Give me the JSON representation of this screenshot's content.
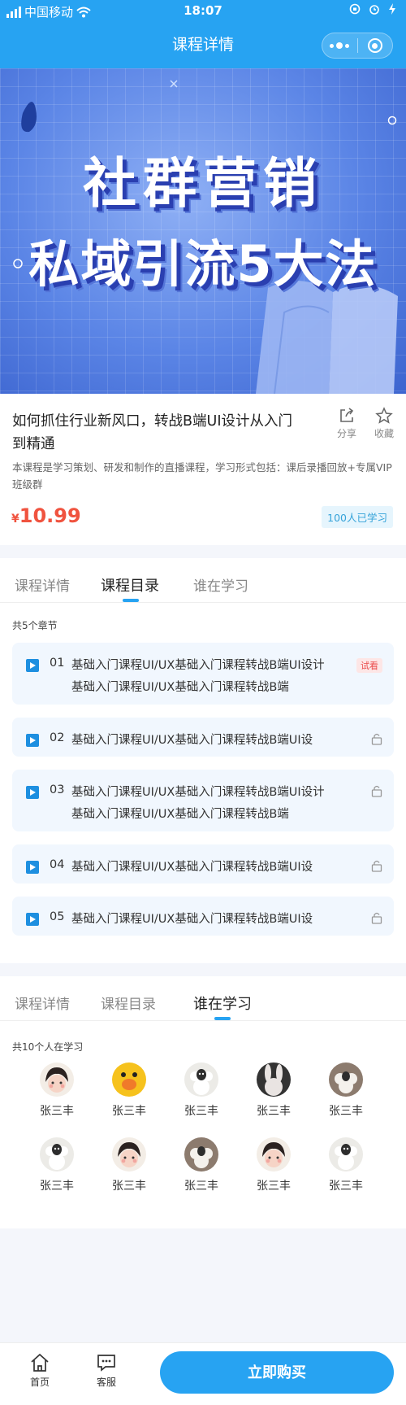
{
  "status_bar": {
    "carrier": "中国移动",
    "time": "18:07"
  },
  "nav": {
    "title": "课程详情"
  },
  "banner": {
    "line1": "社群营销",
    "line2": "私域引流5大法"
  },
  "course": {
    "title": "如何抓住行业新风口，转战B端UI设计从入门到精通",
    "description": "本课程是学习策划、研发和制作的直播课程，学习形式包括：课后录播回放+专属VIP班级群",
    "price_symbol": "¥",
    "price": "10.99",
    "learners_badge": "100人已学习",
    "share_label": "分享",
    "favorite_label": "收藏"
  },
  "tabs": [
    "课程详情",
    "课程目录",
    "谁在学习"
  ],
  "catalog": {
    "count_label": "共5个章节",
    "trial_label": "试看",
    "chapters": [
      {
        "num": "01",
        "title": "基础入门课程UI/UX基础入门课程转战B端UI设计基础入门课程UI/UX基础入门课程转战B端",
        "status": "trial"
      },
      {
        "num": "02",
        "title": "基础入门课程UI/UX基础入门课程转战B端UI设",
        "status": "locked"
      },
      {
        "num": "03",
        "title": "基础入门课程UI/UX基础入门课程转战B端UI设计基础入门课程UI/UX基础入门课程转战B端",
        "status": "locked"
      },
      {
        "num": "04",
        "title": "基础入门课程UI/UX基础入门课程转战B端UI设",
        "status": "locked"
      },
      {
        "num": "05",
        "title": "基础入门课程UI/UX基础入门课程转战B端UI设",
        "status": "locked"
      }
    ]
  },
  "learners": {
    "count_label": "共10个人在学习",
    "people": [
      {
        "name": "张三丰",
        "avatar": "girl-avatar"
      },
      {
        "name": "张三丰",
        "avatar": "duck-avatar"
      },
      {
        "name": "张三丰",
        "avatar": "sheep-avatar"
      },
      {
        "name": "张三丰",
        "avatar": "rabbit-avatar"
      },
      {
        "name": "张三丰",
        "avatar": "sheep-avatar"
      },
      {
        "name": "张三丰",
        "avatar": "sheep-avatar"
      },
      {
        "name": "张三丰",
        "avatar": "girl-avatar"
      },
      {
        "name": "张三丰",
        "avatar": "sheep-avatar"
      },
      {
        "name": "张三丰",
        "avatar": "girl-avatar"
      },
      {
        "name": "张三丰",
        "avatar": "sheep-avatar"
      }
    ]
  },
  "bottom_bar": {
    "home_label": "首页",
    "service_label": "客服",
    "buy_label": "立即购买"
  },
  "colors": {
    "primary": "#27a3f2",
    "price": "#f0533f",
    "chapter_bg": "#f1f7fe"
  }
}
